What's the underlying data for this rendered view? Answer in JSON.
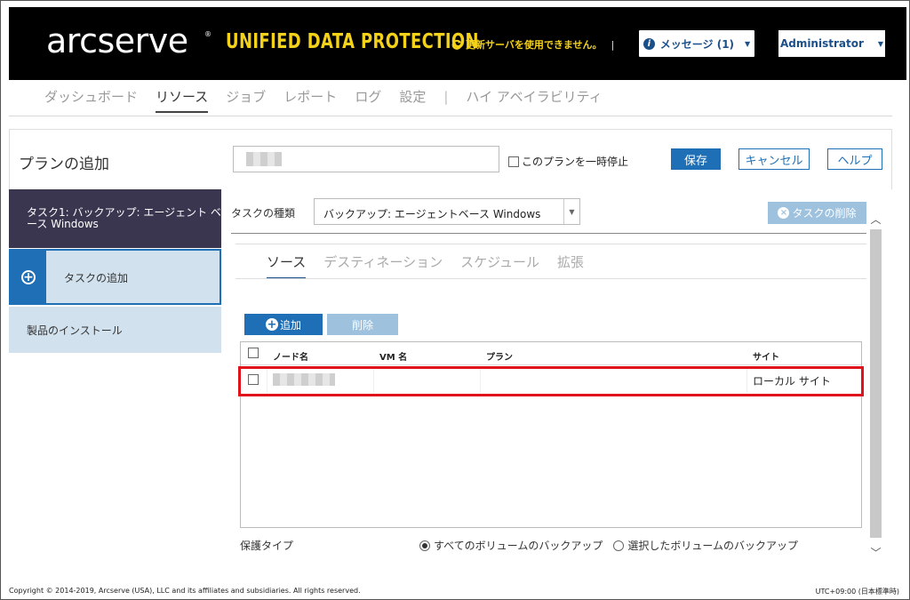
{
  "header": {
    "logo": "arcserve",
    "logo_mark": "®",
    "product": "UNIFIED DATA PROTECTION",
    "update_message": "更新サーバを使用できません。",
    "separator": "|",
    "messages_label": "メッセージ (1)",
    "user_label": "Administrator"
  },
  "nav": {
    "items": [
      "ダッシュボード",
      "リソース",
      "ジョブ",
      "レポート",
      "ログ",
      "設定",
      "ハイ アベイラビリティ"
    ],
    "active": "リソース"
  },
  "plan": {
    "title": "プランの追加",
    "name_value": "",
    "pause_label": "このプランを一時停止",
    "save_label": "保存",
    "cancel_label": "キャンセル",
    "help_label": "ヘルプ"
  },
  "left_panel": {
    "task1_label": "タスク1: バックアップ: エージェント ベース Windows",
    "add_task_label": "タスクの追加",
    "install_label": "製品のインストール"
  },
  "task": {
    "type_label": "タスクの種類",
    "type_value": "バックアップ: エージェントベース Windows",
    "delete_task_label": "タスクの削除",
    "subtabs": [
      "ソース",
      "デスティネーション",
      "スケジュール",
      "拡張"
    ],
    "active_subtab": "ソース",
    "add_label": "追加",
    "remove_label": "削除"
  },
  "grid": {
    "columns": [
      "ノード名",
      "VM 名",
      "プラン",
      "サイト"
    ],
    "rows": [
      {
        "node": "",
        "vm": "",
        "plan": "",
        "site": "ローカル サイト"
      }
    ]
  },
  "protection": {
    "label": "保護タイプ",
    "options": [
      "すべてのボリュームのバックアップ",
      "選択したボリュームのバックアップ"
    ],
    "selected": "すべてのボリュームのバックアップ"
  },
  "footer": {
    "copyright": "Copyright © 2014-2019, Arcserve (USA), LLC and its affiliates and subsidiaries. All rights reserved.",
    "timezone": "UTC+09:00 (日本標準時)"
  },
  "colors": {
    "header_bg": "#000000",
    "brand_yellow": "#f5d21a",
    "primary_blue": "#1e6fb5",
    "disabled_blue": "#9ec1de",
    "sidebar_dark": "#3b3650",
    "sidebar_light": "#d1e1ed",
    "highlight_red": "#e0121c"
  }
}
